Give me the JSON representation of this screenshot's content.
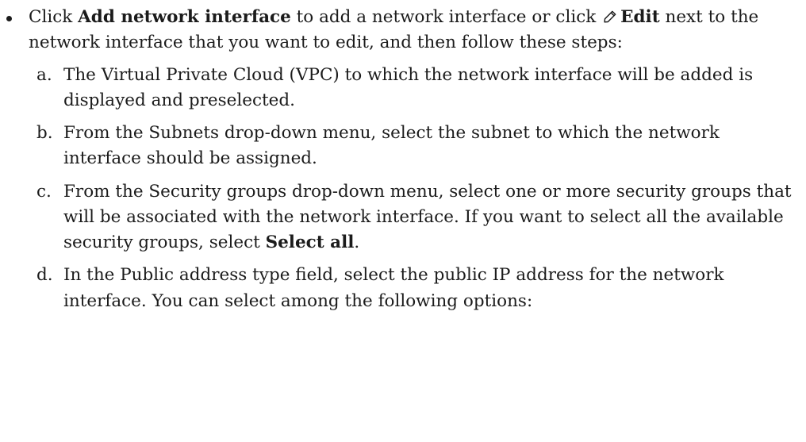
{
  "intro": {
    "pre": "Click ",
    "add_label": "Add network interface",
    "mid": " to add a network interface or click ",
    "edit_label": "Edit",
    "post": " next to the network interface that you want to edit, and then follow these steps:"
  },
  "icons": {
    "edit": "pencil-icon"
  },
  "steps": [
    {
      "marker": "a.",
      "text": "The Virtual Private Cloud (VPC) to which the network interface will be added is displayed and preselected."
    },
    {
      "marker": "b.",
      "text": "From the Subnets drop-down menu, select the subnet to which the network interface should be assigned."
    },
    {
      "marker": "c.",
      "text": "From the Security groups drop-down menu, select one or more security groups that will be associated with the network interface. If you want to select all the available security groups, select ",
      "bold": "Select all",
      "end": "."
    },
    {
      "marker": "d.",
      "text": "In the Public address type field, select the public IP address for the network interface. You can select among the following options:"
    }
  ]
}
